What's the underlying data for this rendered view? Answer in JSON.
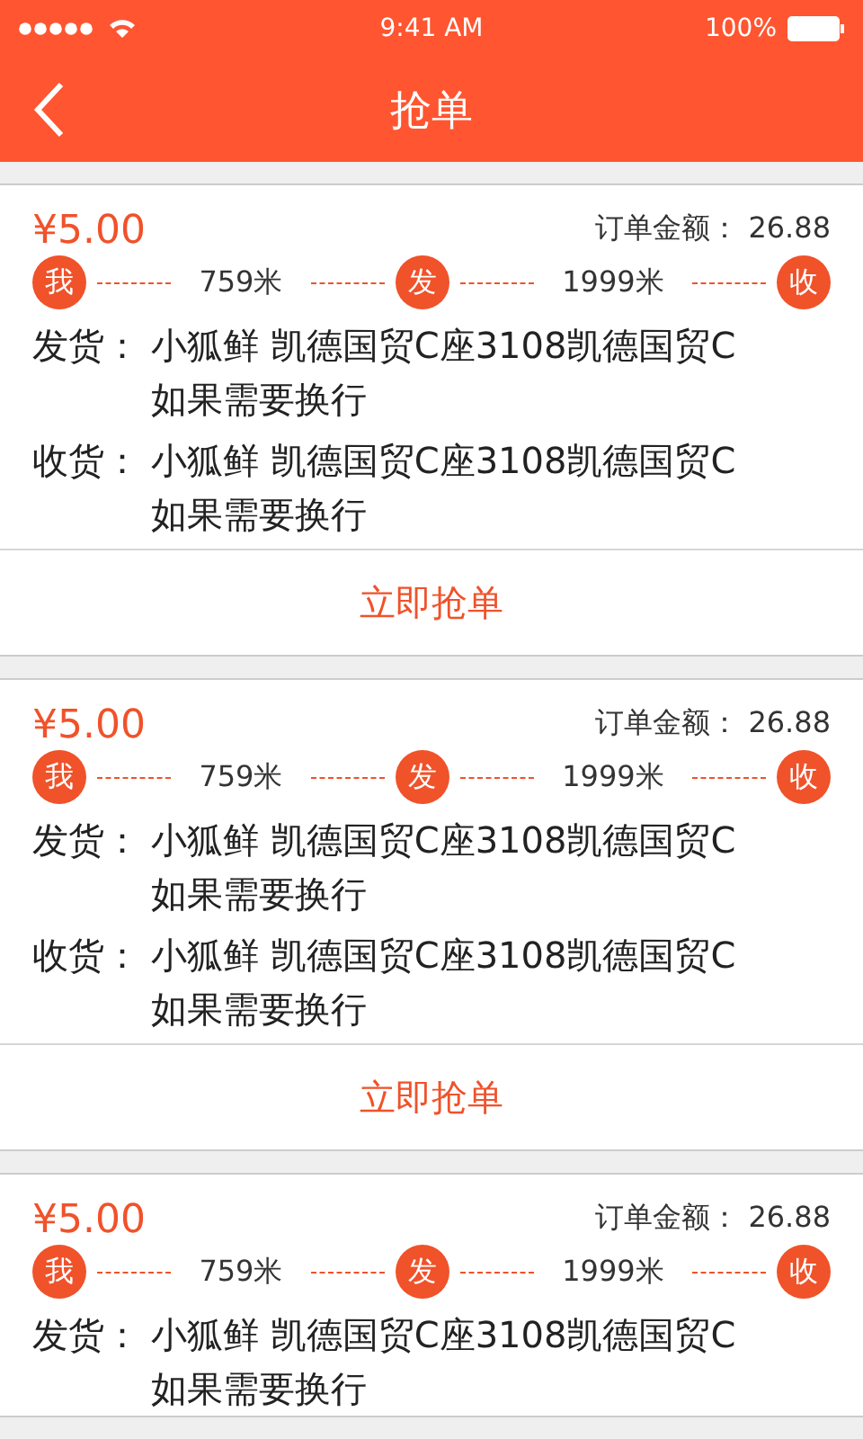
{
  "status_bar": {
    "time": "9:41 AM",
    "battery": "100%"
  },
  "nav": {
    "title": "抢单"
  },
  "orders": [
    {
      "fee": "¥5.00",
      "amount_label": "订单金额：",
      "amount": "26.88",
      "stops": [
        "我",
        "发",
        "收"
      ],
      "distances": [
        "759米",
        "1999米"
      ],
      "addresses": [
        {
          "label": "发货：",
          "lines": [
            "小狐鲜 凯德国贸C座3108凯德国贸C",
            "如果需要换行"
          ]
        },
        {
          "label": "收货：",
          "lines": [
            "小狐鲜 凯德国贸C座3108凯德国贸C",
            "如果需要换行"
          ]
        }
      ],
      "action": "立即抢单"
    },
    {
      "fee": "¥5.00",
      "amount_label": "订单金额：",
      "amount": "26.88",
      "stops": [
        "我",
        "发",
        "收"
      ],
      "distances": [
        "759米",
        "1999米"
      ],
      "addresses": [
        {
          "label": "发货：",
          "lines": [
            "小狐鲜 凯德国贸C座3108凯德国贸C",
            "如果需要换行"
          ]
        },
        {
          "label": "收货：",
          "lines": [
            "小狐鲜 凯德国贸C座3108凯德国贸C",
            "如果需要换行"
          ]
        }
      ],
      "action": "立即抢单"
    },
    {
      "fee": "¥5.00",
      "amount_label": "订单金额：",
      "amount": "26.88",
      "stops": [
        "我",
        "发",
        "收"
      ],
      "distances": [
        "759米",
        "1999米"
      ],
      "addresses": [
        {
          "label": "发货：",
          "lines": [
            "小狐鲜 凯德国贸C座3108凯德国贸C",
            "如果需要换行"
          ]
        }
      ]
    }
  ]
}
